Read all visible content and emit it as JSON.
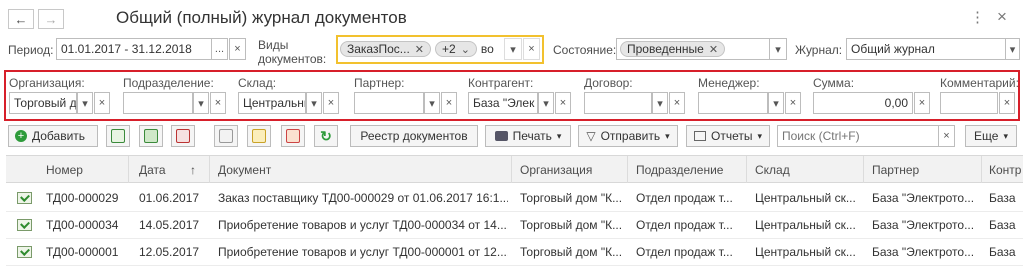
{
  "header": {
    "back_glyph": "←",
    "forward_glyph": "→",
    "title": "Общий (полный) журнал документов",
    "menu_glyph": "⋮",
    "close_glyph": "×"
  },
  "period": {
    "label": "Период:",
    "value": "01.01.2017 - 31.12.2018",
    "more": "...",
    "clear": "×"
  },
  "doc_types": {
    "label": "Виды документов:",
    "tag": "ЗаказПос...",
    "more_count": "+2",
    "typed": "во",
    "clear": "×"
  },
  "status": {
    "label": "Состояние:",
    "tag": "Проведенные"
  },
  "journal": {
    "label": "Журнал:",
    "value": "Общий журнал"
  },
  "filters": [
    {
      "label": "Организация:",
      "value": "Торговый д"
    },
    {
      "label": "Подразделение:",
      "value": ""
    },
    {
      "label": "Склад:",
      "value": "Центральнь"
    },
    {
      "label": "Партнер:",
      "value": ""
    },
    {
      "label": "Контрагент:",
      "value": "База \"Элек"
    },
    {
      "label": "Договор:",
      "value": ""
    },
    {
      "label": "Менеджер:",
      "value": ""
    },
    {
      "label": "Сумма:",
      "value": "0,00"
    },
    {
      "label": "Комментарий:",
      "value": ""
    }
  ],
  "toolbar": {
    "add": "Добавить",
    "registry": "Реестр документов",
    "print": "Печать",
    "send": "Отправить",
    "reports": "Отчеты",
    "search_placeholder": "Поиск (Ctrl+F)",
    "more": "Еще"
  },
  "colors": {
    "accent": "#d71f2a",
    "focus": "#f2c12e",
    "add_icon": "#2e9b3b"
  },
  "table": {
    "columns": [
      "Номер",
      "Дата",
      "Документ",
      "Организация",
      "Подразделение",
      "Склад",
      "Партнер",
      "Контр"
    ],
    "sort_indicator": "↑",
    "rows": [
      [
        "ТД00-000029",
        "01.06.2017",
        "Заказ поставщику ТД00-000029 от 01.06.2017 16:1...",
        "Торговый дом \"К...",
        "Отдел продаж т...",
        "Центральный ск...",
        "База \"Электрото...",
        "База"
      ],
      [
        "ТД00-000034",
        "14.05.2017",
        "Приобретение товаров и услуг ТД00-000034 от 14....",
        "Торговый дом \"К...",
        "Отдел продаж т...",
        "Центральный ск...",
        "База \"Электрото...",
        "База"
      ],
      [
        "ТД00-000001",
        "12.05.2017",
        "Приобретение товаров и услуг ТД00-000001 от 12....",
        "Торговый дом \"К...",
        "Отдел продаж т...",
        "Центральный ск...",
        "База \"Электрото...",
        "База"
      ]
    ]
  }
}
